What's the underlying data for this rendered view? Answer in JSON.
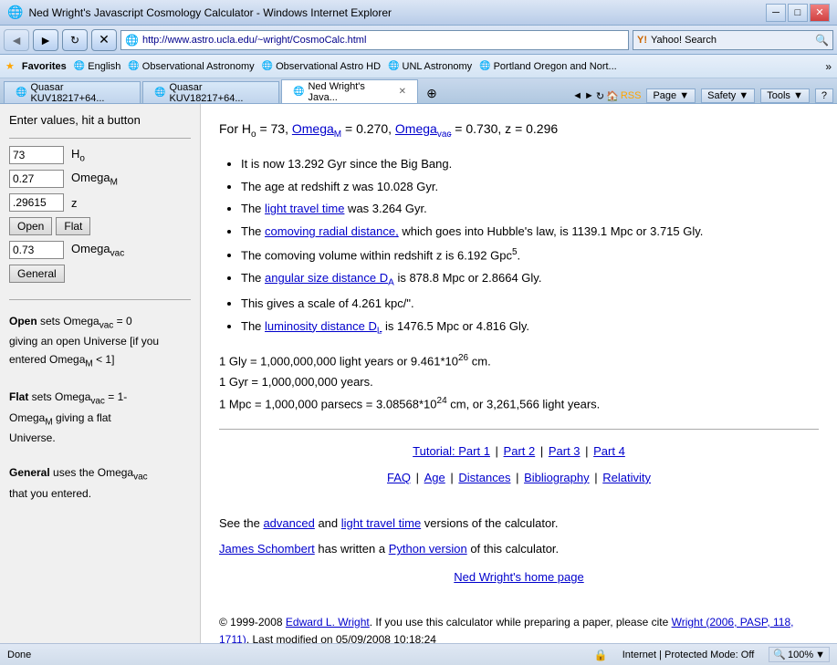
{
  "browser": {
    "title": "Ned Wright's Javascript Cosmology Calculator - Windows Internet Explorer",
    "address": "http://www.astro.ucla.edu/~wright/CosmoCalc.html",
    "search_placeholder": "Yahoo! Search",
    "nav_back": "◄",
    "nav_forward": "►",
    "nav_refresh": "↻",
    "nav_stop": "✕"
  },
  "favorites": {
    "label": "Favorites",
    "items": [
      {
        "label": "English"
      },
      {
        "label": "Observational Astronomy"
      },
      {
        "label": "Observational Astro HD"
      },
      {
        "label": "UNL Astronomy"
      },
      {
        "label": "Portland Oregon and Nort..."
      }
    ]
  },
  "tabs": [
    {
      "label": "Quasar KUV18217+64...",
      "active": false
    },
    {
      "label": "Quasar KUV18217+64...",
      "active": false
    },
    {
      "label": "Ned Wright's Java...",
      "active": true
    }
  ],
  "toolbar": {
    "page_label": "Page ▼",
    "safety_label": "Safety ▼",
    "tools_label": "Tools ▼",
    "help_label": "?"
  },
  "sidebar": {
    "title": "Enter values, hit a button",
    "fields": [
      {
        "id": "H0",
        "value": "73",
        "label": "H",
        "sub": "o"
      },
      {
        "id": "OmegaM",
        "value": "0.27",
        "label": "Omega",
        "sub": "M"
      },
      {
        "id": "z",
        "value": ".29615",
        "label": "z"
      }
    ],
    "buttons": [
      {
        "id": "open",
        "label": "Open"
      },
      {
        "id": "flat",
        "label": "Flat"
      }
    ],
    "omega_vac_value": "0.73",
    "omega_vac_label": "Omega",
    "omega_vac_sub": "vac",
    "general_label": "General",
    "help_text_1": "Open sets Omega",
    "help_omega_vac": "vac",
    "help_text_2": " = 0",
    "help_text_3": "giving an open Universe [if you entered Omega",
    "help_omega_M": "M",
    "help_text_4": " < 1]",
    "help_text_5": "Flat sets Omega",
    "help_flat_vac": "vac",
    "help_text_6": " = 1-",
    "help_text_7": "Omega",
    "help_flat_M": "M",
    "help_text_8": " giving a flat",
    "help_text_9": "Universe.",
    "help_text_10": "General uses the Omega",
    "help_gen_vac": "vac",
    "help_text_11": " that you entered."
  },
  "content": {
    "header": "For H",
    "header_sub": "o",
    "header_rest": " = 73, Omega",
    "header_omega_M": "M",
    "header_val1": " = 0.270, Omega",
    "header_omega_vac": "vac",
    "header_val2": " = 0.730, z = 0.296",
    "results": [
      "It is now 13.292 Gyr since the Big Bang.",
      "The age at redshift z was 10.028 Gyr.",
      "The [light travel time] was 3.264 Gyr.",
      "The [comoving radial distance,] which goes into Hubble's law, is 1139.1 Mpc or 3.715 Gly.",
      "The comoving volume within redshift z is 6.192 Gpc³.",
      "The [angular size distance D_A] is 878.8 Mpc or 2.8664 Gly.",
      "This gives a scale of 4.261 kpc/\".",
      "The [luminosity distance D_L] is 1476.5 Mpc or 4.816 Gly."
    ],
    "result_0": "It is now 13.292 Gyr since the Big Bang.",
    "result_1": "The age at redshift z was 10.028 Gyr.",
    "result_2_pre": "The ",
    "result_2_link": "light travel time",
    "result_2_post": " was 3.264 Gyr.",
    "result_3_pre": "The ",
    "result_3_link": "comoving radial distance,",
    "result_3_post": " which goes into Hubble's law, is 1139.1 Mpc or 3.715 Gly.",
    "result_4": "The comoving volume within redshift z is 6.192 Gpc",
    "result_4_sup": "5",
    "result_5_pre": "The ",
    "result_5_link": "angular size distance D",
    "result_5_link_sub": "A",
    "result_5_post": " is 878.8 Mpc or 2.8664 Gly.",
    "result_6": "This gives a scale of 4.261 kpc/\".",
    "result_7_pre": "The ",
    "result_7_link": "luminosity distance D",
    "result_7_link_sub": "L",
    "result_7_post": " is 1476.5 Mpc or 4.816 Gly.",
    "conv_1": "1 Gly = 1,000,000,000 light years or 9.461*10",
    "conv_1_sup": "26",
    "conv_1_end": " cm.",
    "conv_2": "1 Gyr = 1,000,000,000 years.",
    "conv_3": "1 Mpc = 1,000,000 parsecs = 3.08568*10",
    "conv_3_sup": "24",
    "conv_3_end": " cm, or 3,261,566 light years.",
    "links": [
      {
        "label": "Tutorial: Part 1",
        "url": "#"
      },
      {
        "label": "Part 2",
        "url": "#"
      },
      {
        "label": "Part 3",
        "url": "#"
      },
      {
        "label": "Part 4",
        "url": "#"
      }
    ],
    "links2": [
      {
        "label": "FAQ",
        "url": "#"
      },
      {
        "label": "Age",
        "url": "#"
      },
      {
        "label": "Distances",
        "url": "#"
      },
      {
        "label": "Bibliography",
        "url": "#"
      },
      {
        "label": "Relativity",
        "url": "#"
      }
    ],
    "see_text_1": "See the ",
    "see_link_advanced": "advanced",
    "see_text_2": " and ",
    "see_link_ltt": "light travel time",
    "see_text_3": " versions of the calculator.",
    "james_text_1": "",
    "james_link": "James Schombert",
    "james_text_2": " has written a ",
    "python_link": "Python version",
    "james_text_3": " of this calculator.",
    "ned_link": "Ned Wright's home page",
    "copyright": "© 1999-2008 ",
    "copyright_link": "Edward L. Wright",
    "copyright_rest": ". If you use this calculator while preparing a paper, please cite ",
    "cite_link": "Wright (2006, PASP, 118, 1711)",
    "cite_rest": ". Last modified on 05/09/2008 10:18:24"
  },
  "status": {
    "left": "Done",
    "internet": "Internet | Protected Mode: Off",
    "zoom": "100%"
  }
}
